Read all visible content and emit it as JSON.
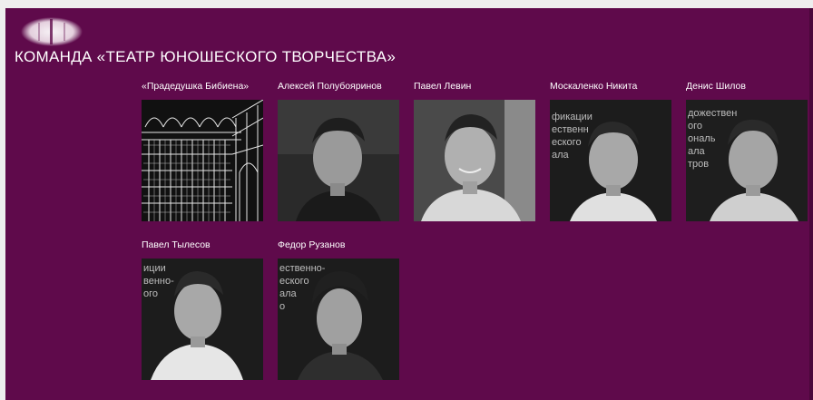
{
  "header": {
    "title": "КОМАНДА «ТЕАТР ЮНОШЕСКОГО ТВОРЧЕСТВА»",
    "logo_icon": "circle-logo-icon"
  },
  "team": [
    {
      "name": "«Прадедушка Бибиена»",
      "photo": "theatre-stage-drawing"
    },
    {
      "name": "Алексей Полубояринов",
      "photo": "portrait"
    },
    {
      "name": "Павел Левин",
      "photo": "portrait"
    },
    {
      "name": "Москаленко Никита",
      "photo": "portrait"
    },
    {
      "name": "Денис Шилов",
      "photo": "portrait"
    },
    {
      "name": "Павел Тылесов",
      "photo": "portrait"
    },
    {
      "name": "Федор Рузанов",
      "photo": "portrait"
    }
  ],
  "colors": {
    "background": "#5f0a4b",
    "text": "#ffffff"
  }
}
